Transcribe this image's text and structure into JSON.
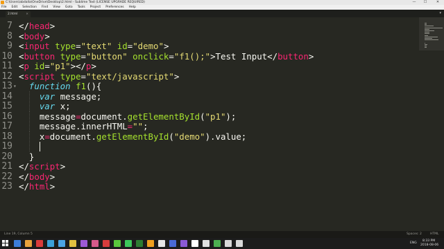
{
  "window": {
    "title": "C:\\Users\\abdalla\\OneDrive\\Desktop\\2.html - Sublime Text (LICENSE UPGRADE REQUIRED)",
    "minimize": "—",
    "maximize": "☐",
    "close": "✕"
  },
  "menu": [
    "File",
    "Edit",
    "Selection",
    "Find",
    "View",
    "Goto",
    "Tools",
    "Project",
    "Preferences",
    "Help"
  ],
  "tab": {
    "label": "2.html",
    "close": "×",
    "menu_glyph": "▾"
  },
  "editor": {
    "lines": [
      {
        "n": "7",
        "fold": "",
        "tokens": [
          [
            "pn",
            "</"
          ],
          [
            "tg",
            "head"
          ],
          [
            "pn",
            ">"
          ]
        ]
      },
      {
        "n": "8",
        "fold": "",
        "tokens": [
          [
            "pn",
            "<"
          ],
          [
            "tg",
            "body"
          ],
          [
            "pn",
            ">"
          ]
        ]
      },
      {
        "n": "9",
        "fold": "",
        "tokens": [
          [
            "pn",
            "<"
          ],
          [
            "tg",
            "input"
          ],
          [
            "pn",
            " "
          ],
          [
            "at",
            "type"
          ],
          [
            "pn",
            "="
          ],
          [
            "st",
            "\"text\""
          ],
          [
            "pn",
            " "
          ],
          [
            "at",
            "id"
          ],
          [
            "pn",
            "="
          ],
          [
            "st",
            "\"demo\""
          ],
          [
            "pn",
            ">"
          ]
        ]
      },
      {
        "n": "10",
        "fold": "",
        "tokens": [
          [
            "pn",
            "<"
          ],
          [
            "tg",
            "button"
          ],
          [
            "pn",
            " "
          ],
          [
            "at",
            "type"
          ],
          [
            "pn",
            "="
          ],
          [
            "st",
            "\"button\""
          ],
          [
            "pn",
            " "
          ],
          [
            "at",
            "onclick"
          ],
          [
            "pn",
            "="
          ],
          [
            "st",
            "\"f1();\""
          ],
          [
            "pn",
            ">Test Input</"
          ],
          [
            "tg",
            "button"
          ],
          [
            "pn",
            ">"
          ]
        ]
      },
      {
        "n": "11",
        "fold": "",
        "tokens": [
          [
            "pn",
            "<"
          ],
          [
            "tg",
            "p"
          ],
          [
            "pn",
            " "
          ],
          [
            "at",
            "id"
          ],
          [
            "pn",
            "="
          ],
          [
            "st",
            "\"p1\""
          ],
          [
            "pn",
            "></"
          ],
          [
            "tg",
            "p"
          ],
          [
            "pn",
            ">"
          ]
        ]
      },
      {
        "n": "12",
        "fold": "",
        "tokens": [
          [
            "pn",
            "<"
          ],
          [
            "tg",
            "script"
          ],
          [
            "pn",
            " "
          ],
          [
            "at",
            "type"
          ],
          [
            "pn",
            "="
          ],
          [
            "st",
            "\"text/javascript\""
          ],
          [
            "pn",
            ">"
          ]
        ]
      },
      {
        "n": "13",
        "fold": "▾",
        "tokens": [
          [
            "pn",
            "  "
          ],
          [
            "kw",
            "function"
          ],
          [
            "pn",
            " "
          ],
          [
            "fn",
            "f1"
          ],
          [
            "pn",
            "(){"
          ]
        ]
      },
      {
        "n": "14",
        "fold": "",
        "tokens": [
          [
            "pn",
            "    "
          ],
          [
            "kw",
            "var"
          ],
          [
            "pn",
            " message;"
          ]
        ]
      },
      {
        "n": "15",
        "fold": "",
        "tokens": [
          [
            "pn",
            "    "
          ],
          [
            "kw",
            "var"
          ],
          [
            "pn",
            " x;"
          ]
        ]
      },
      {
        "n": "16",
        "fold": "",
        "tokens": [
          [
            "pn",
            "    message"
          ],
          [
            "op",
            "="
          ],
          [
            "pn",
            "document."
          ],
          [
            "fn",
            "getElementById"
          ],
          [
            "pn",
            "("
          ],
          [
            "st",
            "\"p1\""
          ],
          [
            "pn",
            ");"
          ]
        ]
      },
      {
        "n": "17",
        "fold": "",
        "tokens": [
          [
            "pn",
            "    message.innerHTML"
          ],
          [
            "op",
            "="
          ],
          [
            "st",
            "\"\""
          ],
          [
            "pn",
            ";"
          ]
        ]
      },
      {
        "n": "18",
        "fold": "",
        "tokens": [
          [
            "pn",
            "    x"
          ],
          [
            "op",
            "="
          ],
          [
            "pn",
            "document."
          ],
          [
            "fn",
            "getElementById"
          ],
          [
            "pn",
            "("
          ],
          [
            "st",
            "\"demo\""
          ],
          [
            "pn",
            ").value;"
          ]
        ]
      },
      {
        "n": "19",
        "fold": "",
        "tokens": [
          [
            "pn",
            ""
          ]
        ]
      },
      {
        "n": "20",
        "fold": "",
        "tokens": [
          [
            "pn",
            "  }"
          ]
        ]
      },
      {
        "n": "21",
        "fold": "",
        "tokens": [
          [
            "pn",
            "</"
          ],
          [
            "tg",
            "script"
          ],
          [
            "pn",
            ">"
          ]
        ]
      },
      {
        "n": "22",
        "fold": "",
        "tokens": [
          [
            "pn",
            "</"
          ],
          [
            "tg",
            "body"
          ],
          [
            "pn",
            ">"
          ]
        ]
      },
      {
        "n": "23",
        "fold": "",
        "tokens": [
          [
            "pn",
            "</"
          ],
          [
            "tg",
            "html"
          ],
          [
            "pn",
            ">"
          ]
        ]
      }
    ]
  },
  "status": {
    "position": "Line 19, Column 5",
    "indent": "Spaces: 2",
    "syntax": "HTML"
  },
  "taskbar": {
    "lang": "ENG",
    "time": "8:33 PM",
    "date": "2018-08-06",
    "icon_colors": [
      "#3c7dd9",
      "#e8a33c",
      "#d93c3c",
      "#3ca0d9",
      "#4ba3e3",
      "#e0c040",
      "#9d5ad6",
      "#d65a8a",
      "#d63c3c",
      "#5ac83c",
      "#3cc85a",
      "#2d7d32",
      "#f0a020",
      "#e6e6e6",
      "#4a6ad6",
      "#8a5ad6",
      "#ffffff",
      "#e0e0e0",
      "#4caf50",
      "#d9d9d9",
      "#d9d9d9"
    ]
  }
}
